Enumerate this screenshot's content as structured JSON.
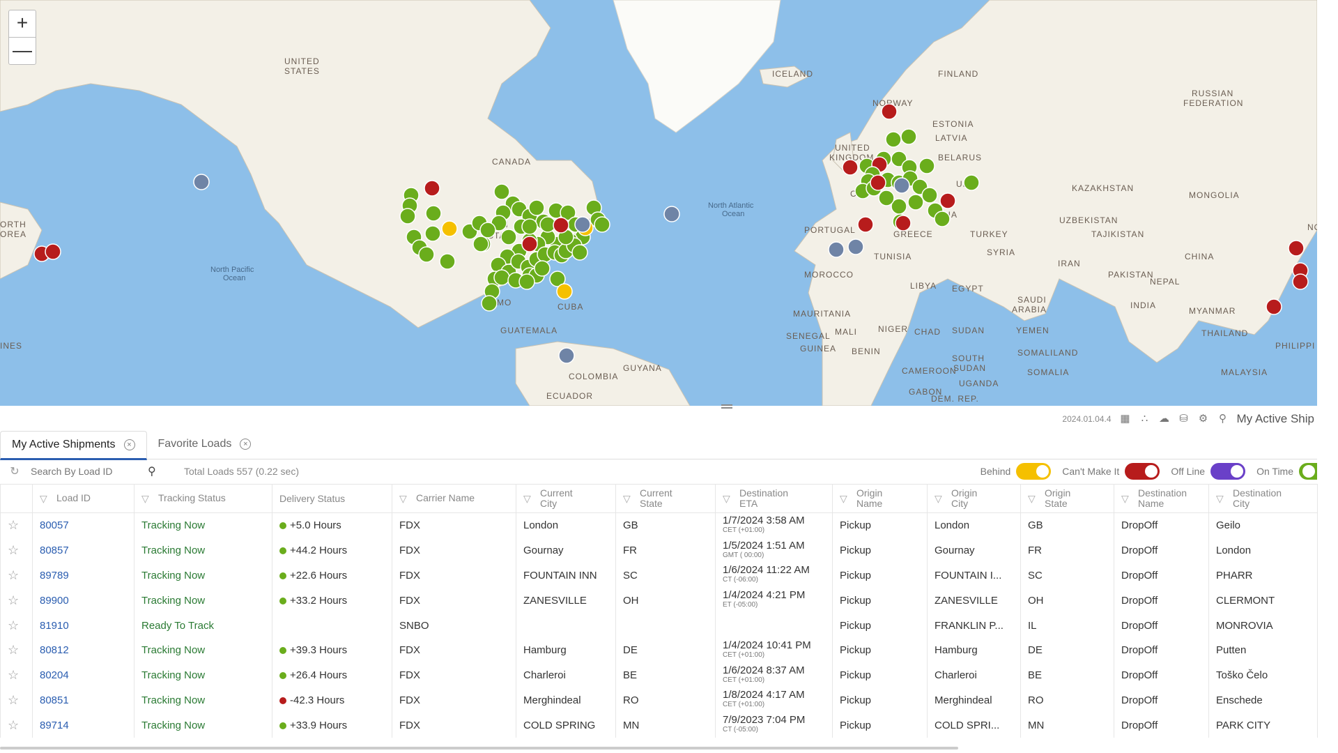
{
  "map": {
    "zoom_in": "+",
    "zoom_out": "—",
    "countries": [
      "UNITED STATES",
      "CANADA",
      "ICELAND",
      "FINLAND",
      "RUSSIAN FEDERATION",
      "NORWAY",
      "ESTONIA",
      "LATVIA",
      "UNITED KINGDOM",
      "BELARUS",
      "KAZAKHSTAN",
      "MONGOLIA",
      "UZBEKISTAN",
      "TAJIKISTAN",
      "PORTUGAL",
      "TURKEY",
      "GREECE",
      "SYRIA",
      "IRAN",
      "CHINA",
      "PAKISTAN",
      "NEPAL",
      "TUNISIA",
      "MOROCCO",
      "LIBYA",
      "EGYPT",
      "SAUDI ARABIA",
      "INDIA",
      "MYANMAR",
      "THAILAND",
      "MAURITANIA",
      "MALI",
      "NIGER",
      "CHAD",
      "SUDAN",
      "YEMEN",
      "SENEGAL",
      "GUINEA",
      "BENIN",
      "SOUTH SUDAN",
      "SOMALIA",
      "SOMALILAND",
      "CAMEROON",
      "UGANDA",
      "GABON",
      "DEM. REP.",
      "MALAYSIA",
      "PHILIPPI",
      "CUBA",
      "GUATEMALA",
      "GUYANA",
      "COLOMBIA",
      "ECUADOR",
      "ORTH",
      "OREA",
      "INES",
      "NO",
      "ARIA",
      "CE",
      "UK",
      "MO",
      "STA",
      "N"
    ],
    "oceans": [
      "North Pacific Ocean",
      "North Atlantic Ocean"
    ],
    "marker_colors": {
      "on_time": "#6aad1c",
      "cant_make_it": "#b71c1c",
      "behind": "#f5c000",
      "off_line": "#6f84a6"
    }
  },
  "toolbar": {
    "version": "2024.01.04.4",
    "icons": [
      "map-icon",
      "cluster-icon",
      "weather-icon",
      "traffic-icon",
      "settings-icon",
      "zoom-search-icon"
    ],
    "title": "My Active Ship"
  },
  "tabs": [
    {
      "label": "My Active Shipments",
      "active": true
    },
    {
      "label": "Favorite Loads",
      "active": false
    }
  ],
  "search": {
    "placeholder": "Search By Load ID",
    "total": "Total Loads 557 (0.22 sec)"
  },
  "legend": {
    "behind": {
      "label": "Behind",
      "color": "#f5c000"
    },
    "cant": {
      "label": "Can't Make It",
      "color": "#b71c1c"
    },
    "offline": {
      "label": "Off Line",
      "color": "#6a40c8"
    },
    "ontime": {
      "label": "On Time",
      "color": "#6aad1c"
    }
  },
  "columns": {
    "load_id": "Load ID",
    "tracking": "Tracking Status",
    "delivery": "Delivery Status",
    "carrier": "Carrier Name",
    "cur_city_1": "Current",
    "cur_city_2": "City",
    "cur_state_1": "Current",
    "cur_state_2": "State",
    "eta_1": "Destination",
    "eta_2": "ETA",
    "orig_name_1": "Origin",
    "orig_name_2": "Name",
    "orig_city_1": "Origin",
    "orig_city_2": "City",
    "orig_state_1": "Origin",
    "orig_state_2": "State",
    "dest_name_1": "Destination",
    "dest_name_2": "Name",
    "dest_city_1": "Destination",
    "dest_city_2": "City"
  },
  "rows": [
    {
      "id": "80057",
      "tracking": "Tracking Now",
      "delivery": "+5.0 Hours",
      "status_color": "#6aad1c",
      "carrier": "FDX",
      "city": "London",
      "state": "GB",
      "eta": "1/7/2024  3:58 AM",
      "tz": "CET (+01:00)",
      "orig_name": "Pickup",
      "orig_city": "London",
      "orig_state": "GB",
      "dest_name": "DropOff",
      "dest_city": "Geilo"
    },
    {
      "id": "80857",
      "tracking": "Tracking Now",
      "delivery": "+44.2 Hours",
      "status_color": "#6aad1c",
      "carrier": "FDX",
      "city": "Gournay",
      "state": "FR",
      "eta": "1/5/2024  1:51 AM",
      "tz": "GMT ( 00:00)",
      "orig_name": "Pickup",
      "orig_city": "Gournay",
      "orig_state": "FR",
      "dest_name": "DropOff",
      "dest_city": "London"
    },
    {
      "id": "89789",
      "tracking": "Tracking Now",
      "delivery": "+22.6 Hours",
      "status_color": "#6aad1c",
      "carrier": "FDX",
      "city": "FOUNTAIN INN",
      "state": "SC",
      "eta": "1/6/2024  11:22 AM",
      "tz": "CT (-06:00)",
      "orig_name": "Pickup",
      "orig_city": "FOUNTAIN I...",
      "orig_state": "SC",
      "dest_name": "DropOff",
      "dest_city": "PHARR"
    },
    {
      "id": "89900",
      "tracking": "Tracking Now",
      "delivery": "+33.2 Hours",
      "status_color": "#6aad1c",
      "carrier": "FDX",
      "city": "ZANESVILLE",
      "state": "OH",
      "eta": "1/4/2024  4:21 PM",
      "tz": "ET (-05:00)",
      "orig_name": "Pickup",
      "orig_city": "ZANESVILLE",
      "orig_state": "OH",
      "dest_name": "DropOff",
      "dest_city": "CLERMONT"
    },
    {
      "id": "81910",
      "tracking": "Ready To Track",
      "delivery": "",
      "status_color": "",
      "carrier": "SNBO",
      "city": "",
      "state": "",
      "eta": "",
      "tz": "",
      "orig_name": "Pickup",
      "orig_city": "FRANKLIN P...",
      "orig_state": "IL",
      "dest_name": "DropOff",
      "dest_city": "MONROVIA"
    },
    {
      "id": "80812",
      "tracking": "Tracking Now",
      "delivery": "+39.3 Hours",
      "status_color": "#6aad1c",
      "carrier": "FDX",
      "city": "Hamburg",
      "state": "DE",
      "eta": "1/4/2024  10:41 PM",
      "tz": "CET (+01:00)",
      "orig_name": "Pickup",
      "orig_city": "Hamburg",
      "orig_state": "DE",
      "dest_name": "DropOff",
      "dest_city": "Putten"
    },
    {
      "id": "80204",
      "tracking": "Tracking Now",
      "delivery": "+26.4 Hours",
      "status_color": "#6aad1c",
      "carrier": "FDX",
      "city": "Charleroi",
      "state": "BE",
      "eta": "1/6/2024  8:37 AM",
      "tz": "CET (+01:00)",
      "orig_name": "Pickup",
      "orig_city": "Charleroi",
      "orig_state": "BE",
      "dest_name": "DropOff",
      "dest_city": "Toško Čelo"
    },
    {
      "id": "80851",
      "tracking": "Tracking Now",
      "delivery": "-42.3 Hours",
      "status_color": "#b71c1c",
      "carrier": "FDX",
      "city": "Merghindeal",
      "state": "RO",
      "eta": "1/8/2024  4:17 AM",
      "tz": "CET (+01:00)",
      "orig_name": "Pickup",
      "orig_city": "Merghindeal",
      "orig_state": "RO",
      "dest_name": "DropOff",
      "dest_city": "Enschede"
    },
    {
      "id": "89714",
      "tracking": "Tracking Now",
      "delivery": "+33.9 Hours",
      "status_color": "#6aad1c",
      "carrier": "FDX",
      "city": "COLD SPRING",
      "state": "MN",
      "eta": "7/9/2023  7:04 PM",
      "tz": "CT (-05:00)",
      "orig_name": "Pickup",
      "orig_city": "COLD SPRI...",
      "orig_state": "MN",
      "dest_name": "DropOff",
      "dest_city": "PARK CITY"
    }
  ]
}
